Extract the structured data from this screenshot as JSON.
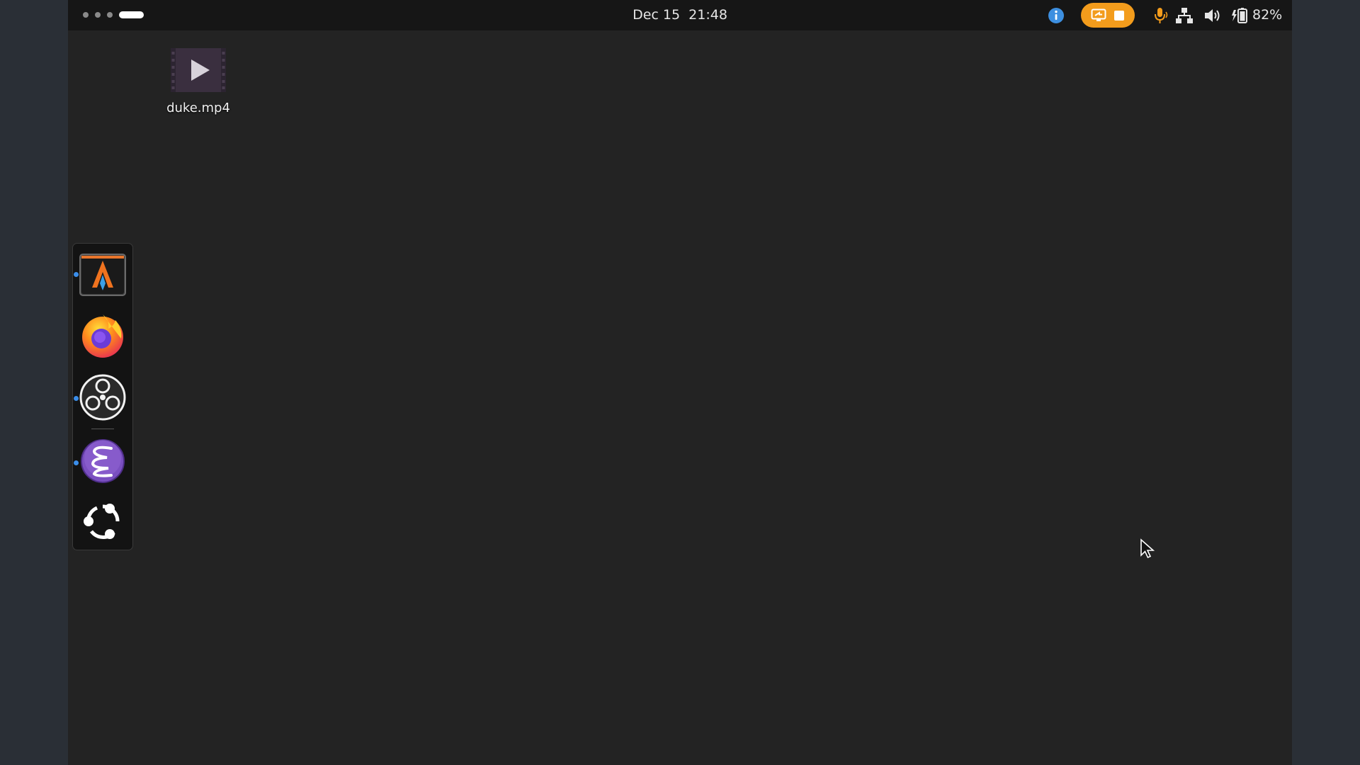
{
  "topbar": {
    "clock": {
      "date": "Dec 15",
      "time": "21:48"
    },
    "battery_percent": "82%",
    "screencast_color": "#f39c1c",
    "tray_icons": [
      "info-icon",
      "screencast-icon",
      "stop-recording-icon",
      "microphone-icon",
      "network-icon",
      "volume-icon",
      "battery-icon"
    ]
  },
  "desktop": {
    "files": [
      {
        "name": "duke.mp4",
        "icon": "video-file-icon"
      }
    ]
  },
  "dock": {
    "apps": [
      {
        "name": "alacritty-terminal",
        "running": true
      },
      {
        "name": "firefox",
        "running": false
      },
      {
        "name": "obs-studio",
        "running": true
      },
      {
        "name": "emacs",
        "running": true
      },
      {
        "name": "show-applications",
        "running": false
      }
    ]
  }
}
